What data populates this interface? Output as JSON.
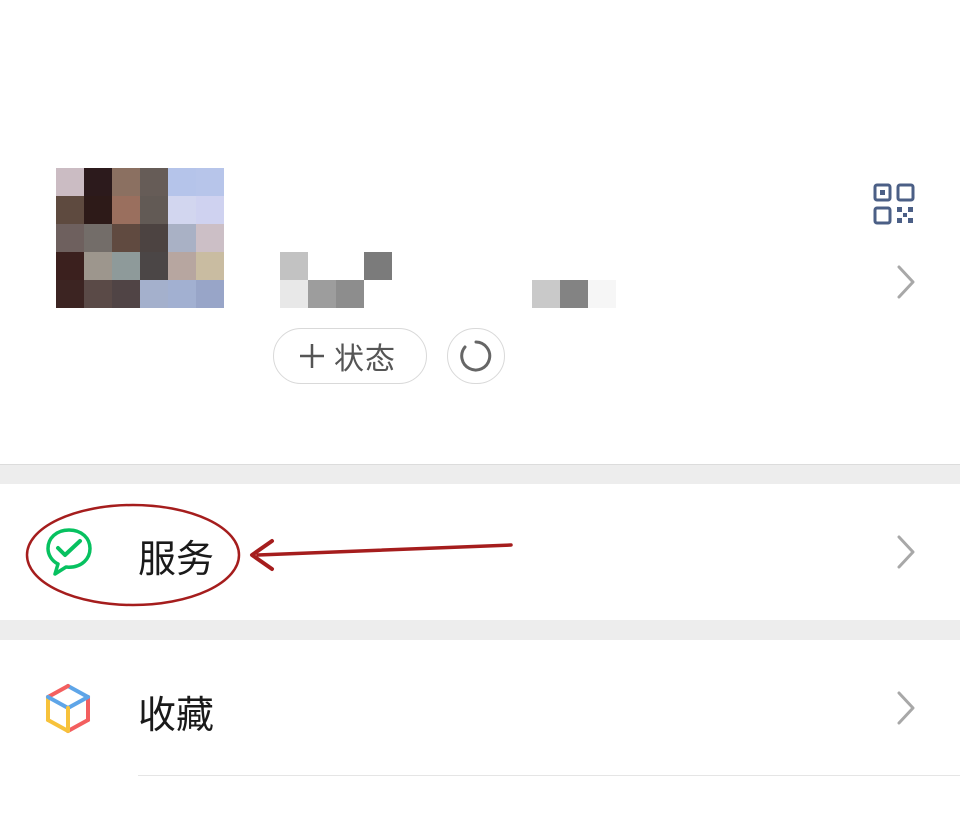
{
  "profile": {
    "avatar_colors": [
      "#cbbcc3",
      "#2c1a1c",
      "#8b7061",
      "#665c57",
      "#b5c4ea",
      "#b7c5ea",
      "#5e4a3f",
      "#2d1a18",
      "#9a6f5e",
      "#625a55",
      "#d2d6ef",
      "#cfd2f0",
      "#6e605e",
      "#736d69",
      "#604a40",
      "#4c4341",
      "#a9b1c5",
      "#ccbfc6",
      "#3b201e",
      "#9d968d",
      "#8e9a9a",
      "#4b4646",
      "#b7a6a0",
      "#c9bca1",
      "#3c2422",
      "#5a4a47",
      "#504445",
      "#a4b0cc",
      "#a2b0d1",
      "#98a5c8"
    ],
    "status_button_label": "状态",
    "icons": {
      "qr": "qr-code-icon",
      "chevron": "chevron-right-icon",
      "plus": "plus-icon",
      "refresh": "refresh-ring-icon"
    }
  },
  "menu": {
    "items": [
      {
        "label": "服务",
        "icon": "wechat-pay-icon",
        "icon_color": "#07c160"
      },
      {
        "label": "收藏",
        "icon": "favorites-cube-icon"
      }
    ]
  },
  "colors": {
    "accent_green": "#07c160",
    "annotation_red": "#a51d1d",
    "separator_gray": "#ededed"
  }
}
